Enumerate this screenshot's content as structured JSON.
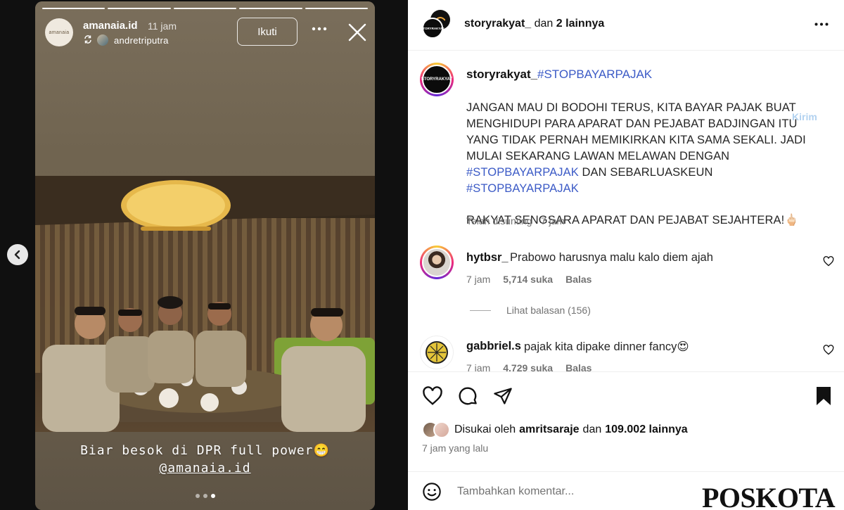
{
  "story": {
    "username": "amanaia.id",
    "time": "11 jam",
    "avatar_text": "amanaia",
    "reposted_by": "andretriputra",
    "follow_label": "Ikuti",
    "caption_line1": "Biar besok di DPR full power😁",
    "caption_line2": "@amanaia.id",
    "icons": {
      "more": "more-horizontal-icon",
      "close": "close-icon",
      "repost": "repost-icon",
      "prev": "chevron-left-icon"
    }
  },
  "post": {
    "header": {
      "username": "storyrakyat_",
      "suffix": "dan",
      "others": "2 lainnya",
      "avatar_text": "STORYRAKYAT"
    },
    "caption": {
      "username": "storyrakyat_",
      "hashtag": "#STOPBAYARPAJAK",
      "para1_a": "JANGAN MAU DI BODOHI TERUS, KITA BAYAR PAJAK BUAT MENGHIDUPI PARA APARAT DAN PEJABAT BADJINGAN ITU YANG TIDAK PERNAH MEMIKIRKAN KITA SAMA SEKALI. JADI MULAI SEKARANG LAWAN MELAWAN DENGAN ",
      "para1_tag1": "#STOPBAYARPAJAK",
      "para1_b": " DAN SEBARLUASKEUN ",
      "para1_tag2": "#STOPBAYARPAJAK",
      "para2": "RAKYAT SENGSARA APARAT DAN PEJABAT SEJAHTERA!🖕🏻",
      "meta": "Telah disunting · 7 jam"
    },
    "comments": [
      {
        "username": "hytbsr_",
        "text": "Prabowo harusnya malu kalo diem ajah",
        "time": "7 jam",
        "likes": "5,714 suka",
        "reply": "Balas",
        "view_replies": "Lihat balasan (156)"
      },
      {
        "username": "gabbriel.s",
        "text": "pajak kita dipake dinner fancy😍",
        "time": "7 jam",
        "likes": "4.729 suka",
        "reply": "Balas"
      }
    ],
    "likes": {
      "prefix": "Disukai oleh",
      "user": "amritsaraje",
      "mid": "dan",
      "count": "109.002 lainnya"
    },
    "time_ago": "7 jam yang lalu",
    "comment_placeholder": "Tambahkan komentar...",
    "send_label": "Kirim"
  },
  "watermark": "POSKOTA",
  "colors": {
    "link": "#3b5ac6",
    "muted": "#737373",
    "send_disabled": "#b2d2f0"
  }
}
